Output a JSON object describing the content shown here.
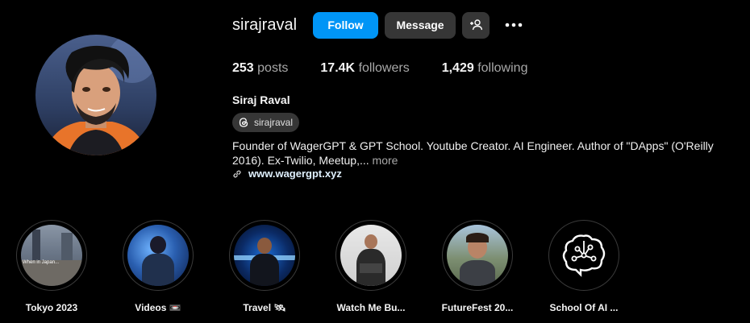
{
  "profile": {
    "username": "sirajraval",
    "follow_label": "Follow",
    "message_label": "Message",
    "full_name": "Siraj Raval",
    "threads_handle": "sirajraval",
    "bio": "Founder of WagerGPT & GPT School. Youtube Creator. AI Engineer. Author of \"DApps\" (O'Reilly 2016). Ex-Twilio, Meetup,...",
    "bio_more": "more",
    "website": "www.wagergpt.xyz"
  },
  "stats": {
    "posts_count": "253",
    "posts_label": "posts",
    "followers_count": "17.4K",
    "followers_label": "followers",
    "following_count": "1,429",
    "following_label": "following"
  },
  "highlights": [
    {
      "label": "Tokyo 2023",
      "thumb_text": "When in Japan..."
    },
    {
      "label": "Videos 📼"
    },
    {
      "label": "Travel 🛰"
    },
    {
      "label": "Watch Me Bu..."
    },
    {
      "label": "FutureFest 20..."
    },
    {
      "label": "School Of AI ..."
    }
  ],
  "icons": {
    "add_user": "add-user-icon",
    "more": "more-options-icon",
    "threads": "threads-icon",
    "link": "link-icon"
  },
  "colors": {
    "background": "#000000",
    "follow_button": "#0095f6",
    "secondary_button": "#363636",
    "muted_text": "#a8a8a8"
  }
}
